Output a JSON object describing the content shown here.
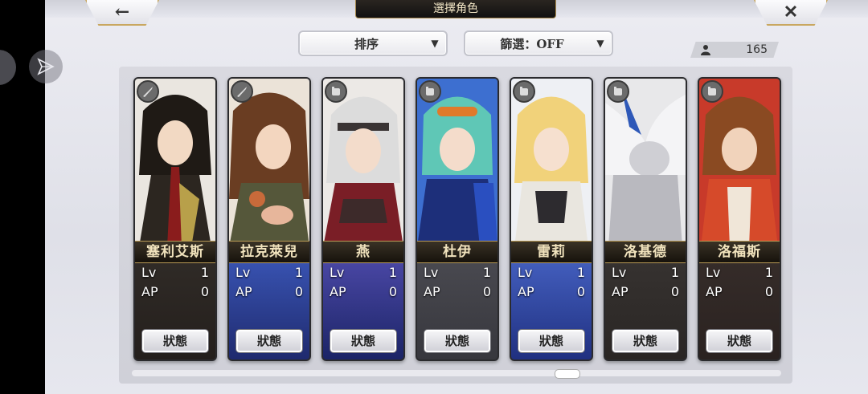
{
  "header": {
    "title": "選擇角色",
    "back_icon": "←",
    "close_icon": "✕"
  },
  "controls": {
    "sort_label": "排序",
    "filter_label": "篩選：OFF",
    "caret": "▼",
    "character_count": "165"
  },
  "cards": [
    {
      "name": "塞利艾斯",
      "lv_label": "Lv",
      "lv": "1",
      "ap_label": "AP",
      "ap": "0",
      "status_label": "狀態",
      "weapon": "sword-icon"
    },
    {
      "name": "拉克萊兒",
      "lv_label": "Lv",
      "lv": "1",
      "ap_label": "AP",
      "ap": "0",
      "status_label": "狀態",
      "weapon": "sword-icon"
    },
    {
      "name": "燕",
      "lv_label": "Lv",
      "lv": "1",
      "ap_label": "AP",
      "ap": "0",
      "status_label": "狀態",
      "weapon": "fist-icon"
    },
    {
      "name": "杜伊",
      "lv_label": "Lv",
      "lv": "1",
      "ap_label": "AP",
      "ap": "0",
      "status_label": "狀態",
      "weapon": "fist-icon"
    },
    {
      "name": "雷莉",
      "lv_label": "Lv",
      "lv": "1",
      "ap_label": "AP",
      "ap": "0",
      "status_label": "狀態",
      "weapon": "fist-icon"
    },
    {
      "name": "洛基德",
      "lv_label": "Lv",
      "lv": "1",
      "ap_label": "AP",
      "ap": "0",
      "status_label": "狀態",
      "weapon": "fist-icon"
    },
    {
      "name": "洛福斯",
      "lv_label": "Lv",
      "lv": "1",
      "ap_label": "AP",
      "ap": "0",
      "status_label": "狀態",
      "weapon": "fist-icon"
    }
  ],
  "colors": {
    "gold_border": "#c9a760",
    "name_text": "#f1e3bd",
    "panel_bg": "#d5d6dd"
  }
}
